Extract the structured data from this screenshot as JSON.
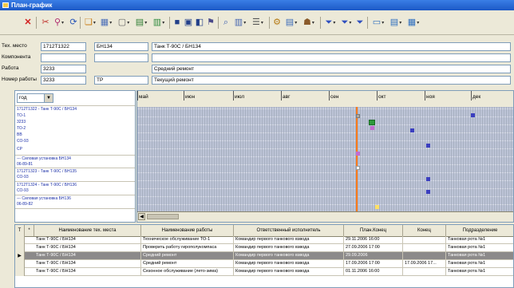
{
  "window": {
    "title": "План-график"
  },
  "toolbar": {
    "icons": [
      "delete-icon",
      "cut-icon",
      "find-icon",
      "refresh-icon",
      "copy-icon",
      "table-icon",
      "frame-icon",
      "chart-icon",
      "export-icon",
      "print-icon",
      "preview-icon",
      "print-setup-icon",
      "pin-icon",
      "search-icon",
      "columns-icon",
      "list-icon",
      "settings-icon",
      "filter-icon",
      "filter-check-icon",
      "filter-clear-icon",
      "window-icon",
      "form-icon",
      "help-icon"
    ]
  },
  "form": {
    "tech_place_label": "Тех. место",
    "tech_place_code": "1712Т1322",
    "tech_place_id": "БН134",
    "tech_place_name": "Танк Т-90С / БН134",
    "component_label": "Компонента",
    "work_label": "Работа",
    "work_code": "3233",
    "work_name": "Средний ремонт",
    "work_number_label": "Номер работы",
    "work_number_value": "3233",
    "work_type": "ТР",
    "work_type_name": "Текущий ремонт"
  },
  "left_panel": {
    "period": "год",
    "items": [
      "1712Т1322 - Танк Т-90С / БН134",
      "ТО-1",
      "3233",
      "ТО-2",
      "ВВ",
      "СО-93",
      "СР",
      "--- Силовая установка БН134",
      "06-89-81",
      "1712Т1323 - Танк Т-90С / БН135",
      "СО-93",
      "1712Т1324 - Танк Т-90С / БН136",
      "СО-93",
      "--- Силовая установка БН136",
      "06-89-82"
    ]
  },
  "gantt": {
    "months": [
      "май",
      "июн",
      "июл",
      "авг",
      "сен",
      "окт",
      "ноя",
      "дек"
    ],
    "colors": {
      "today_line": "#ff7a1a",
      "marker_gray": "#b0aaa0",
      "marker_blue": "#3b3fbf",
      "marker_green": "#2e9a3c",
      "marker_magenta": "#c46bd0",
      "marker_yellow": "#ffe066"
    }
  },
  "table": {
    "headers": [
      "Т",
      "*",
      "Наименование тех. места",
      "Наименование работы",
      "Ответственный исполнитель",
      "План.Конец",
      "Конец",
      "Подразделение"
    ],
    "rows": [
      {
        "place": "Танк Т-90С / БН134",
        "work": "Техническое обслуживание ТО-1",
        "resp": "Командир первого танкового взвода",
        "plan_end": "29.11.2006 16:00",
        "end": "",
        "unit": "Танковая рота №1"
      },
      {
        "place": "Танк Т-90С / БН134",
        "work": "Проверить работу гирополукомпаса",
        "resp": "Командир первого танкового взвода",
        "plan_end": "27.09.2006 17:00",
        "end": "",
        "unit": "Танковая рота №1"
      },
      {
        "place": "Танк Т-90С / БН134",
        "work": "Средний ремонт",
        "resp": "Командир первого танкового взвода",
        "plan_end": "29.09.2006",
        "end": "",
        "unit": "Танковая рота №1"
      },
      {
        "place": "Танк Т-90С / БН134",
        "work": "Средний ремонт",
        "resp": "Командир первого танкового взвода",
        "plan_end": "17.09.2006 17:00",
        "end": "17.09.2006 17...",
        "unit": "Танковая рота №1"
      },
      {
        "place": "Танк Т-90С / БН134",
        "work": "Сезонное обслуживание (лето-зима)",
        "resp": "Командир первого танкового взвода",
        "plan_end": "01.11.2006 16:00",
        "end": "",
        "unit": "Танковая рота №1"
      }
    ]
  }
}
